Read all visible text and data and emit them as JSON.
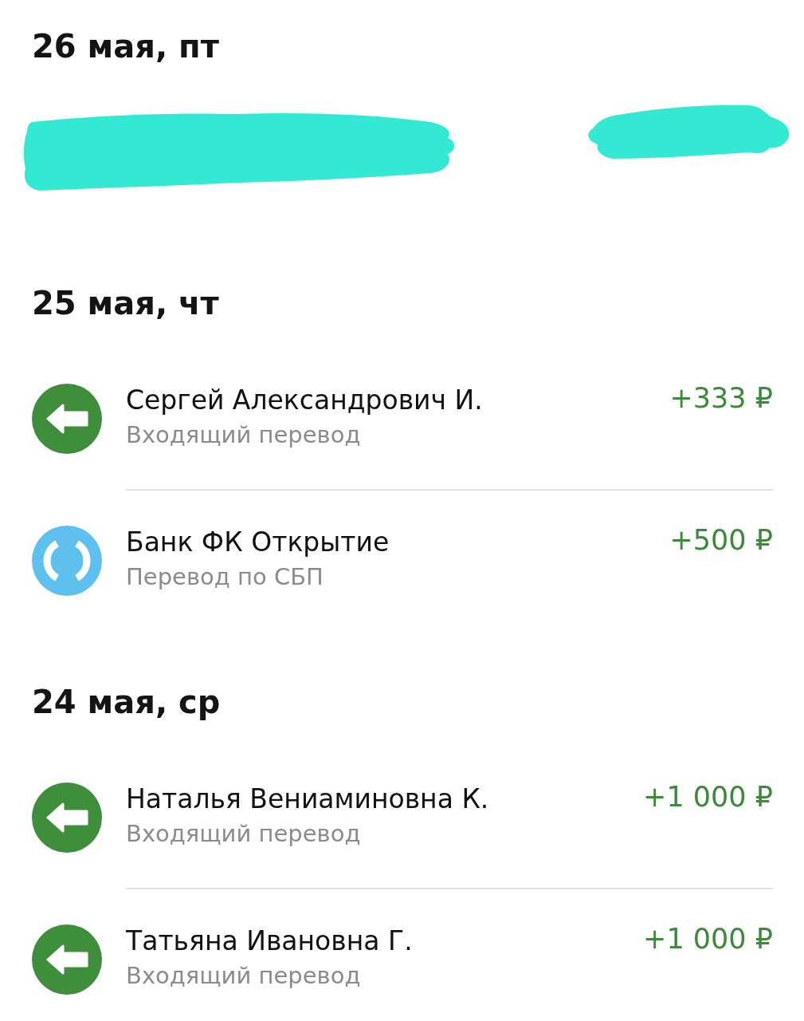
{
  "days": [
    {
      "date": "26 мая, пт",
      "transactions": [
        {
          "kind": "redacted"
        }
      ]
    },
    {
      "date": "25 мая, чт",
      "transactions": [
        {
          "kind": "incoming",
          "name": "Сергей Александрович И.",
          "subtitle": "Входящий перевод",
          "amount": "+333 ₽"
        },
        {
          "kind": "sbp",
          "name": "Банк ФК Открытие",
          "subtitle": "Перевод по СБП",
          "amount": "+500 ₽"
        }
      ]
    },
    {
      "date": "24 мая, ср",
      "transactions": [
        {
          "kind": "incoming",
          "name": "Наталья Вениаминовна К.",
          "subtitle": "Входящий перевод",
          "amount": "+1 000 ₽"
        },
        {
          "kind": "incoming",
          "name": "Татьяна Ивановна Г.",
          "subtitle": "Входящий перевод",
          "amount": "+1 000 ₽"
        }
      ]
    }
  ]
}
